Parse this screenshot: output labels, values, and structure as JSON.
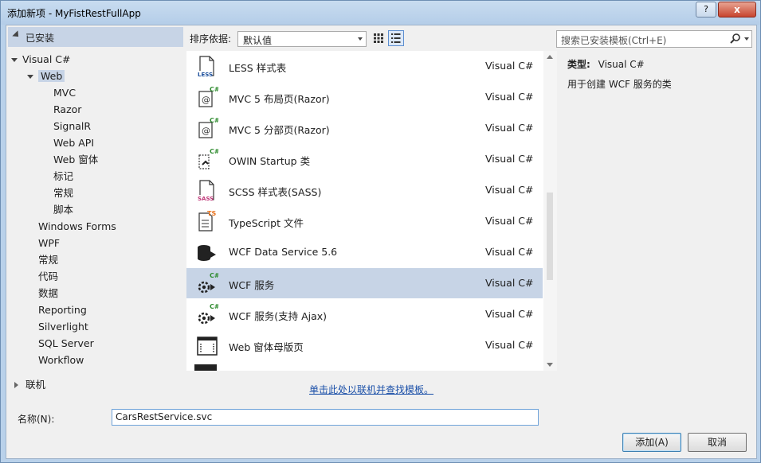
{
  "window": {
    "title": "添加新项 - MyFistRestFullApp",
    "help_label": "?",
    "close_label": "x"
  },
  "left": {
    "installed_label": "已安装",
    "online_label": "联机",
    "tree": [
      {
        "label": "Visual C#",
        "level": 1,
        "expanded": true
      },
      {
        "label": "Web",
        "level": 2,
        "expanded": true,
        "selected": true
      },
      {
        "label": "MVC",
        "level": 3
      },
      {
        "label": "Razor",
        "level": 3
      },
      {
        "label": "SignalR",
        "level": 3
      },
      {
        "label": "Web API",
        "level": 3
      },
      {
        "label": "Web 窗体",
        "level": 3
      },
      {
        "label": "标记",
        "level": 3
      },
      {
        "label": "常规",
        "level": 3
      },
      {
        "label": "脚本",
        "level": 3
      },
      {
        "label": "Windows Forms",
        "level": 2
      },
      {
        "label": "WPF",
        "level": 2
      },
      {
        "label": "常规",
        "level": 2
      },
      {
        "label": "代码",
        "level": 2
      },
      {
        "label": "数据",
        "level": 2
      },
      {
        "label": "Reporting",
        "level": 2
      },
      {
        "label": "Silverlight",
        "level": 2
      },
      {
        "label": "SQL Server",
        "level": 2
      },
      {
        "label": "Workflow",
        "level": 2
      }
    ]
  },
  "center": {
    "sort_label": "排序依据:",
    "sort_value": "默认值",
    "items": [
      {
        "name": "LESS 样式表",
        "lang": "Visual C#",
        "icon": "less-file-icon"
      },
      {
        "name": "MVC 5 布局页(Razor)",
        "lang": "Visual C#",
        "icon": "razor-layout-icon"
      },
      {
        "name": "MVC 5 分部页(Razor)",
        "lang": "Visual C#",
        "icon": "razor-partial-icon"
      },
      {
        "name": "OWIN Startup 类",
        "lang": "Visual C#",
        "icon": "owin-startup-icon"
      },
      {
        "name": "SCSS 样式表(SASS)",
        "lang": "Visual C#",
        "icon": "sass-file-icon"
      },
      {
        "name": "TypeScript 文件",
        "lang": "Visual C#",
        "icon": "typescript-file-icon"
      },
      {
        "name": "WCF Data Service 5.6",
        "lang": "Visual C#",
        "icon": "wcf-data-service-icon"
      },
      {
        "name": "WCF 服务",
        "lang": "Visual C#",
        "icon": "wcf-service-icon",
        "selected": true
      },
      {
        "name": "WCF 服务(支持 Ajax)",
        "lang": "Visual C#",
        "icon": "wcf-ajax-service-icon"
      },
      {
        "name": "Web 窗体母版页",
        "lang": "Visual C#",
        "icon": "master-page-icon"
      }
    ],
    "online_link": "单击此处以联机并查找模板。"
  },
  "right": {
    "search_placeholder": "搜索已安装模板(Ctrl+E)",
    "type_label": "类型:",
    "type_value": "Visual C#",
    "description": "用于创建 WCF 服务的类"
  },
  "bottom": {
    "name_label": "名称(N):",
    "name_value": "CarsRestService.svc",
    "add_label": "添加(A)",
    "cancel_label": "取消"
  },
  "colors": {
    "selection": "#c7d4e6",
    "link": "#1a4fa8",
    "accent_green": "#2e8b2e",
    "typescript_orange": "#e8731e"
  }
}
